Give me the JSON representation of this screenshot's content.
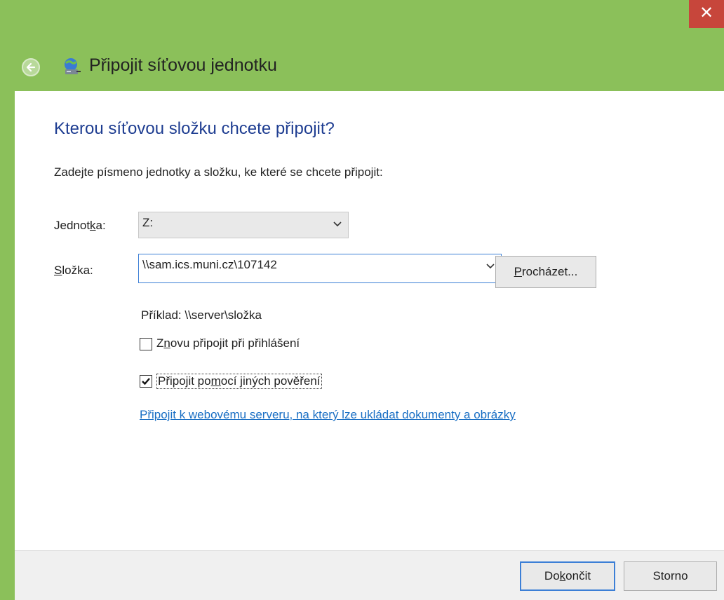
{
  "window": {
    "title": "Připojit síťovou jednotku",
    "close_glyph": "✕",
    "accent_color": "#8bc05a",
    "close_color": "#c7463b"
  },
  "main": {
    "heading": "Kterou síťovou složku chcete připojit?",
    "instruction": "Zadejte písmeno jednotky a složku, ke které se chcete připojit:",
    "drive": {
      "label_pre": "Jednot",
      "label_accel": "k",
      "label_post": "a:",
      "value": "Z:"
    },
    "folder": {
      "label_pre": "",
      "label_accel": "S",
      "label_post": "ložka:",
      "value": "\\\\sam.ics.muni.cz\\107142"
    },
    "browse": {
      "label_accel": "P",
      "label_post": "rocházet..."
    },
    "example": "Příklad: \\\\server\\složka",
    "reconnect": {
      "checked": false,
      "label_pre": "Z",
      "label_accel": "n",
      "label_post": "ovu připojit při přihlášení"
    },
    "credentials": {
      "checked": true,
      "label_pre": "Připojit po",
      "label_accel": "m",
      "label_post": "ocí jiných pověření"
    },
    "link": "Připojit k webovému serveru, na který lze ukládat dokumenty a obrázky"
  },
  "footer": {
    "finish": {
      "label_pre": "Do",
      "label_accel": "k",
      "label_post": "ončit"
    },
    "cancel": "Storno"
  }
}
